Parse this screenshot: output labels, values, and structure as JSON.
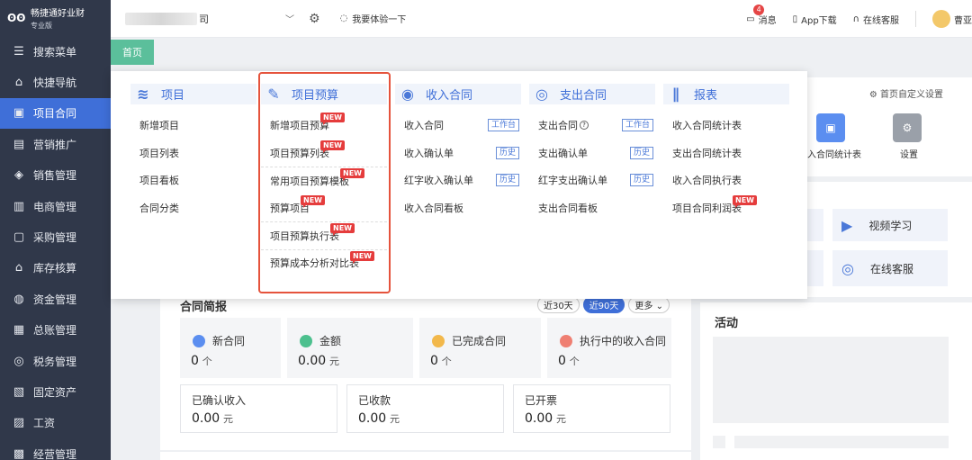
{
  "brand": {
    "name": "畅捷通好业财",
    "edition": "专业版"
  },
  "sidebar": {
    "items": [
      {
        "label": "搜索菜单",
        "icon": "search-menu-icon",
        "glyph": "☰"
      },
      {
        "label": "快捷导航",
        "icon": "home-icon",
        "glyph": "⌂"
      },
      {
        "label": "项目合同",
        "icon": "contract-icon",
        "glyph": "▣",
        "active": true
      },
      {
        "label": "营销推广",
        "icon": "gift-icon",
        "glyph": "▤"
      },
      {
        "label": "销售管理",
        "icon": "sales-icon",
        "glyph": "◈"
      },
      {
        "label": "电商管理",
        "icon": "shop-icon",
        "glyph": "▥"
      },
      {
        "label": "采购管理",
        "icon": "bag-icon",
        "glyph": "▢"
      },
      {
        "label": "库存核算",
        "icon": "warehouse-icon",
        "glyph": "⌂"
      },
      {
        "label": "资金管理",
        "icon": "money-icon",
        "glyph": "◍"
      },
      {
        "label": "总账管理",
        "icon": "ledger-icon",
        "glyph": "▦"
      },
      {
        "label": "税务管理",
        "icon": "tax-icon",
        "glyph": "◎"
      },
      {
        "label": "固定资产",
        "icon": "asset-icon",
        "glyph": "▧"
      },
      {
        "label": "工资",
        "icon": "salary-icon",
        "glyph": "▨"
      },
      {
        "label": "经营管理",
        "icon": "business-icon",
        "glyph": "▩"
      }
    ]
  },
  "topbar": {
    "company_suffix": "司",
    "try_label": "我要体验一下",
    "message_label": "消息",
    "message_count": "4",
    "app_download": "App下载",
    "online_service": "在线客服",
    "user_name": "曹亚"
  },
  "tabs": {
    "home": "首页"
  },
  "mega_menu": {
    "columns": [
      {
        "title": "项目",
        "icon": "project-icon",
        "items": [
          {
            "label": "新增项目"
          },
          {
            "label": "项目列表"
          },
          {
            "label": "项目看板"
          },
          {
            "label": "合同分类"
          }
        ]
      },
      {
        "title": "项目预算",
        "icon": "budget-icon",
        "items": [
          {
            "label": "新增项目预算",
            "new": "NEW"
          },
          {
            "label": "项目预算列表",
            "new": "NEW"
          },
          {
            "label": "常用项目预算模板",
            "new": "NEW",
            "sep": true
          },
          {
            "label": "预算项目",
            "new": "NEW"
          },
          {
            "label": "项目预算执行表",
            "new": "NEW",
            "sep": true
          },
          {
            "label": "预算成本分析对比表",
            "new": "NEW",
            "sep": true
          }
        ]
      },
      {
        "title": "收入合同",
        "icon": "income-contract-icon",
        "items": [
          {
            "label": "收入合同",
            "tag": "工作台"
          },
          {
            "label": "收入确认单",
            "tag": "历史"
          },
          {
            "label": "红字收入确认单",
            "tag": "历史"
          },
          {
            "label": "收入合同看板"
          }
        ]
      },
      {
        "title": "支出合同",
        "icon": "expense-contract-icon",
        "items": [
          {
            "label": "支出合同",
            "help": "?",
            "tag": "工作台"
          },
          {
            "label": "支出确认单",
            "tag": "历史"
          },
          {
            "label": "红字支出确认单",
            "tag": "历史"
          },
          {
            "label": "支出合同看板"
          }
        ]
      },
      {
        "title": "报表",
        "icon": "report-icon",
        "items": [
          {
            "label": "收入合同统计表"
          },
          {
            "label": "支出合同统计表"
          },
          {
            "label": "收入合同执行表"
          },
          {
            "label": "项目合同利润表",
            "new": "NEW"
          }
        ]
      }
    ]
  },
  "home": {
    "custom_settings": "首页自定义设置",
    "quick": [
      {
        "label": "入合同统计表",
        "icon": "chart-card-icon"
      },
      {
        "label": "设置",
        "icon": "gear-icon"
      }
    ],
    "help": [
      {
        "label": "视频学习",
        "icon": "video-icon"
      },
      {
        "label": "在线客服",
        "icon": "headset-icon"
      }
    ],
    "brief": {
      "title": "合同简报",
      "ranges": [
        "近30天",
        "近90天",
        "更多"
      ],
      "kpis": [
        {
          "label": "新合同",
          "value": "0",
          "unit": "个",
          "color": "#5b8ef0"
        },
        {
          "label": "金额",
          "value": "0.00",
          "unit": "元",
          "color": "#4cc08e"
        },
        {
          "label": "已完成合同",
          "value": "0",
          "unit": "个",
          "color": "#f2b84b"
        },
        {
          "label": "执行中的收入合同",
          "value": "0",
          "unit": "个",
          "color": "#ef7f72"
        }
      ],
      "totals": [
        {
          "label": "已确认收入",
          "value": "0.00",
          "unit": "元"
        },
        {
          "label": "已收款",
          "value": "0.00",
          "unit": "元"
        },
        {
          "label": "已开票",
          "value": "0.00",
          "unit": "元"
        }
      ]
    },
    "activity_title": "活动"
  }
}
